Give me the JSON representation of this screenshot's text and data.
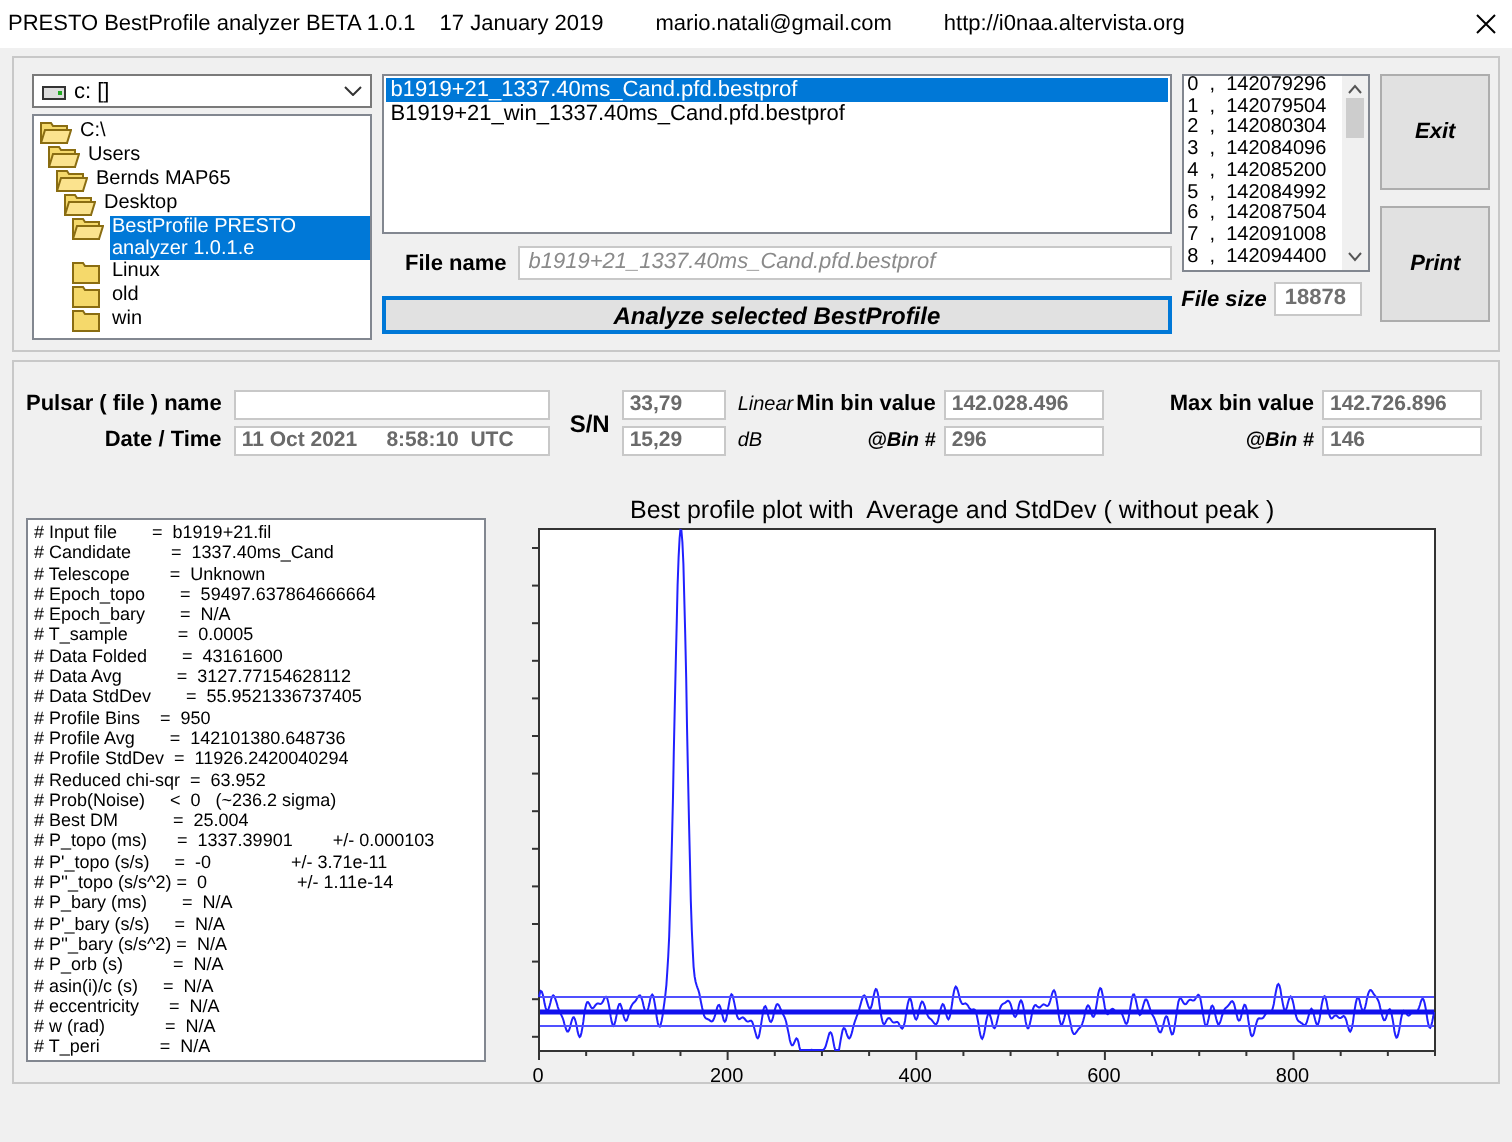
{
  "window": {
    "title": "PRESTO BestProfile analyzer BETA 1.0.1",
    "date": "17 January 2019",
    "email": "mario.natali@gmail.com",
    "website": "http://i0naa.altervista.org"
  },
  "browser": {
    "drive": "c: []",
    "tree": [
      {
        "label": "C:\\",
        "expanded": true,
        "selected": false,
        "children": [
          {
            "label": "Users",
            "expanded": true,
            "selected": false,
            "children": [
              {
                "label": "Bernds MAP65",
                "expanded": true,
                "selected": false,
                "children": [
                  {
                    "label": "Desktop",
                    "expanded": true,
                    "selected": false,
                    "children": [
                      {
                        "label": "BestProfile PRESTO analyzer 1.0.1.e",
                        "expanded": true,
                        "selected": true
                      },
                      {
                        "label": "Linux",
                        "expanded": false,
                        "selected": false
                      },
                      {
                        "label": "old",
                        "expanded": false,
                        "selected": false
                      },
                      {
                        "label": "win",
                        "expanded": false,
                        "selected": false
                      }
                    ]
                  }
                ]
              }
            ]
          }
        ]
      }
    ],
    "files": [
      {
        "name": "b1919+21_1337.40ms_Cand.pfd.bestprof",
        "selected": true
      },
      {
        "name": "B1919+21_win_1337.40ms_Cand.pfd.bestprof",
        "selected": false
      }
    ],
    "file_name": {
      "label": "File name",
      "value": "b1919+21_1337.40ms_Cand.pfd.bestprof"
    },
    "analyze_button": "Analyze selected BestProfile",
    "bins": [
      "0  ,  142079296",
      "1  ,  142079504",
      "2  ,  142080304",
      "3  ,  142084096",
      "4  ,  142085200",
      "5  ,  142084992",
      "6  ,  142087504",
      "7  ,  142091008",
      "8  ,  142094400"
    ],
    "file_size": {
      "label": "File size",
      "value": "18878"
    },
    "buttons": [
      "Exit",
      "Print"
    ]
  },
  "results": {
    "pulsar_name": {
      "label": "Pulsar ( file ) name"
    },
    "date_time": {
      "label": "Date / Time",
      "value": "11 Oct 2021     8:58:10  UTC"
    },
    "sn": {
      "label": "S/N",
      "linear": "33,79",
      "linear_unit": "Linear",
      "db": "15,29",
      "db_unit": "dB"
    },
    "min": {
      "label": "Min bin value",
      "value": "142.028.496",
      "bin_label": "@Bin #",
      "bin": "296"
    },
    "max": {
      "label": "Max bin value",
      "value": "142.726.896",
      "bin_label": "@Bin #",
      "bin": "146"
    },
    "header_lines": [
      "# Input file       =  b1919+21.fil",
      "# Candidate        =  1337.40ms_Cand",
      "# Telescope        =  Unknown",
      "# Epoch_topo       =  59497.637864666664",
      "# Epoch_bary       =  N/A",
      "# T_sample          =  0.0005",
      "# Data Folded       =  43161600",
      "# Data Avg           =  3127.77154628112",
      "# Data StdDev       =  55.9521336737405",
      "# Profile Bins    =  950",
      "# Profile Avg       =  142101380.648736",
      "# Profile StdDev  =  11926.2420040294",
      "# Reduced chi-sqr  =  63.952",
      "# Prob(Noise)     <  0   (~236.2 sigma)",
      "# Best DM           =  25.004",
      "# P_topo (ms)      =  1337.39901        +/- 0.000103",
      "# P'_topo (s/s)     =  -0                +/- 3.71e-11",
      "# P''_topo (s/s^2) =  0                  +/- 1.11e-14",
      "# P_bary (ms)       =  N/A",
      "# P'_bary (s/s)     =  N/A",
      "# P''_bary (s/s^2) =  N/A",
      "# P_orb (s)          =  N/A",
      "# asin(i)/c (s)     =  N/A",
      "# eccentricity      =  N/A",
      "# w (rad)            =  N/A",
      "# T_peri            =  N/A"
    ],
    "chart": {
      "title": "Best profile plot with  Average and StdDev ( without peak )",
      "x_tick_labels": [
        "0",
        "200",
        "400",
        "600",
        "800"
      ]
    }
  }
}
